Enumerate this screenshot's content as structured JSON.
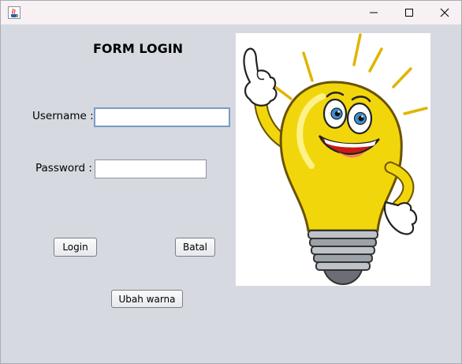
{
  "window": {
    "title": "",
    "icons": {
      "app": "java-cup-icon",
      "minimize": "minimize-icon",
      "maximize": "maximize-icon",
      "close": "close-icon"
    }
  },
  "form": {
    "title": "FORM LOGIN",
    "username_label": "Username :",
    "username_value": "",
    "password_label": "Password :",
    "password_value": "",
    "login_button": "Login",
    "cancel_button": "Batal",
    "change_color_button": "Ubah warna"
  },
  "illustration": {
    "subject": "cartoon-lightbulb-illustration"
  },
  "colors": {
    "background": "#d6d9e0",
    "titlebar": "#f7f1f3",
    "field_focus_border": "#7a9cc2"
  }
}
